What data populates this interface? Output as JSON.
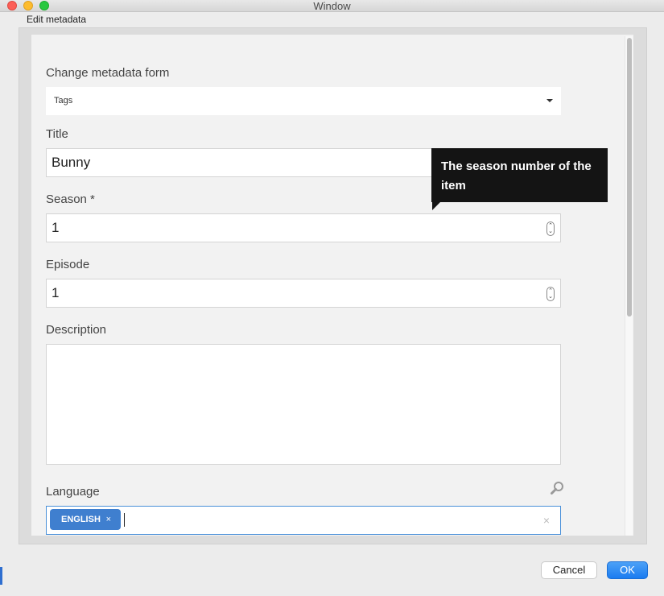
{
  "window": {
    "title": "Window"
  },
  "dialog": {
    "title": "Edit metadata"
  },
  "form": {
    "metadata_form": {
      "label": "Change metadata form",
      "value": "Tags"
    },
    "title": {
      "label": "Title",
      "value": "Bunny"
    },
    "season": {
      "label": "Season *",
      "value": "1",
      "tooltip": "The season number of the item"
    },
    "episode": {
      "label": "Episode",
      "value": "1"
    },
    "description": {
      "label": "Description",
      "value": ""
    },
    "language": {
      "label": "Language",
      "tags": [
        "ENGLISH"
      ],
      "tag_remove": "×",
      "clear": "×"
    }
  },
  "buttons": {
    "cancel": "Cancel",
    "ok": "OK"
  },
  "spinner_glyphs": {
    "up": "⌃",
    "down": "⌄"
  },
  "colors": {
    "accent": "#1b7cf0",
    "chip": "#3f7fcf",
    "tooltip_bg": "#141414",
    "close": "#fc5f57",
    "minimize": "#fdbc2e",
    "maximize": "#28c840"
  },
  "icons": [
    "caret-down-icon",
    "spinner-icon",
    "search-icon",
    "close-icon"
  ]
}
